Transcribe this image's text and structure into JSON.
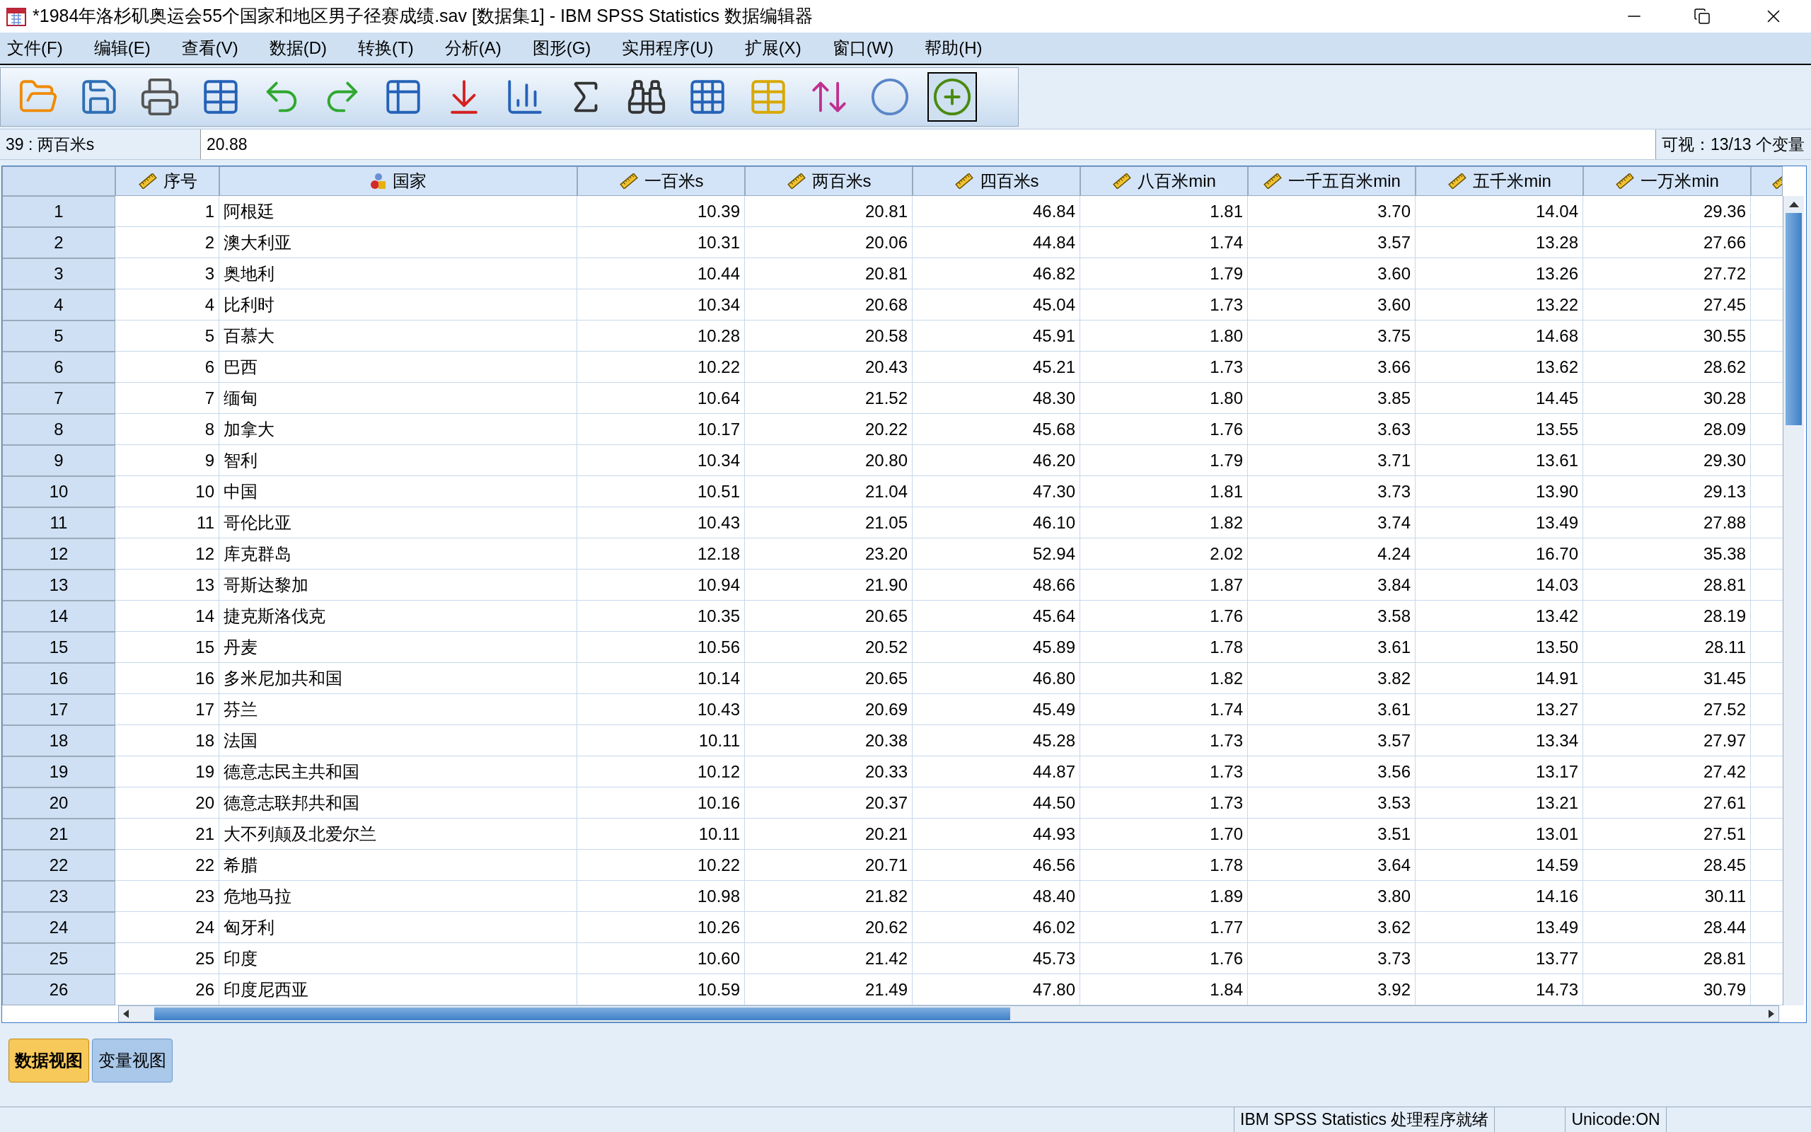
{
  "window": {
    "title": "*1984年洛杉矶奥运会55个国家和地区男子径赛成绩.sav [数据集1] - IBM SPSS Statistics 数据编辑器"
  },
  "menu": [
    "文件(F)",
    "编辑(E)",
    "查看(V)",
    "数据(D)",
    "转换(T)",
    "分析(A)",
    "图形(G)",
    "实用程序(U)",
    "扩展(X)",
    "窗口(W)",
    "帮助(H)"
  ],
  "cell_editor": {
    "reference": "39 : 两百米s",
    "value": "20.88",
    "visible_count": "可视：13/13 个变量"
  },
  "table": {
    "columns": [
      {
        "label": "序号",
        "kind": "scale"
      },
      {
        "label": "国家",
        "kind": "nominal"
      },
      {
        "label": "一百米s",
        "kind": "scale"
      },
      {
        "label": "两百米s",
        "kind": "scale"
      },
      {
        "label": "四百米s",
        "kind": "scale"
      },
      {
        "label": "八百米min",
        "kind": "scale"
      },
      {
        "label": "一千五百米min",
        "kind": "scale"
      },
      {
        "label": "五千米min",
        "kind": "scale"
      },
      {
        "label": "一万米min",
        "kind": "scale"
      }
    ],
    "rows": [
      {
        "number": "1",
        "cells": [
          "1",
          "阿根廷",
          "10.39",
          "20.81",
          "46.84",
          "1.81",
          "3.70",
          "14.04",
          "29.36"
        ]
      },
      {
        "number": "2",
        "cells": [
          "2",
          "澳大利亚",
          "10.31",
          "20.06",
          "44.84",
          "1.74",
          "3.57",
          "13.28",
          "27.66"
        ]
      },
      {
        "number": "3",
        "cells": [
          "3",
          "奥地利",
          "10.44",
          "20.81",
          "46.82",
          "1.79",
          "3.60",
          "13.26",
          "27.72"
        ]
      },
      {
        "number": "4",
        "cells": [
          "4",
          "比利时",
          "10.34",
          "20.68",
          "45.04",
          "1.73",
          "3.60",
          "13.22",
          "27.45"
        ]
      },
      {
        "number": "5",
        "cells": [
          "5",
          "百慕大",
          "10.28",
          "20.58",
          "45.91",
          "1.80",
          "3.75",
          "14.68",
          "30.55"
        ]
      },
      {
        "number": "6",
        "cells": [
          "6",
          "巴西",
          "10.22",
          "20.43",
          "45.21",
          "1.73",
          "3.66",
          "13.62",
          "28.62"
        ]
      },
      {
        "number": "7",
        "cells": [
          "7",
          "缅甸",
          "10.64",
          "21.52",
          "48.30",
          "1.80",
          "3.85",
          "14.45",
          "30.28"
        ]
      },
      {
        "number": "8",
        "cells": [
          "8",
          "加拿大",
          "10.17",
          "20.22",
          "45.68",
          "1.76",
          "3.63",
          "13.55",
          "28.09"
        ]
      },
      {
        "number": "9",
        "cells": [
          "9",
          "智利",
          "10.34",
          "20.80",
          "46.20",
          "1.79",
          "3.71",
          "13.61",
          "29.30"
        ]
      },
      {
        "number": "10",
        "cells": [
          "10",
          "中国",
          "10.51",
          "21.04",
          "47.30",
          "1.81",
          "3.73",
          "13.90",
          "29.13"
        ]
      },
      {
        "number": "11",
        "cells": [
          "11",
          "哥伦比亚",
          "10.43",
          "21.05",
          "46.10",
          "1.82",
          "3.74",
          "13.49",
          "27.88"
        ]
      },
      {
        "number": "12",
        "cells": [
          "12",
          "库克群岛",
          "12.18",
          "23.20",
          "52.94",
          "2.02",
          "4.24",
          "16.70",
          "35.38"
        ]
      },
      {
        "number": "13",
        "cells": [
          "13",
          "哥斯达黎加",
          "10.94",
          "21.90",
          "48.66",
          "1.87",
          "3.84",
          "14.03",
          "28.81"
        ]
      },
      {
        "number": "14",
        "cells": [
          "14",
          "捷克斯洛伐克",
          "10.35",
          "20.65",
          "45.64",
          "1.76",
          "3.58",
          "13.42",
          "28.19"
        ]
      },
      {
        "number": "15",
        "cells": [
          "15",
          "丹麦",
          "10.56",
          "20.52",
          "45.89",
          "1.78",
          "3.61",
          "13.50",
          "28.11"
        ]
      },
      {
        "number": "16",
        "cells": [
          "16",
          "多米尼加共和国",
          "10.14",
          "20.65",
          "46.80",
          "1.82",
          "3.82",
          "14.91",
          "31.45"
        ]
      },
      {
        "number": "17",
        "cells": [
          "17",
          "芬兰",
          "10.43",
          "20.69",
          "45.49",
          "1.74",
          "3.61",
          "13.27",
          "27.52"
        ]
      },
      {
        "number": "18",
        "cells": [
          "18",
          "法国",
          "10.11",
          "20.38",
          "45.28",
          "1.73",
          "3.57",
          "13.34",
          "27.97"
        ]
      },
      {
        "number": "19",
        "cells": [
          "19",
          "德意志民主共和国",
          "10.12",
          "20.33",
          "44.87",
          "1.73",
          "3.56",
          "13.17",
          "27.42"
        ]
      },
      {
        "number": "20",
        "cells": [
          "20",
          "德意志联邦共和国",
          "10.16",
          "20.37",
          "44.50",
          "1.73",
          "3.53",
          "13.21",
          "27.61"
        ]
      },
      {
        "number": "21",
        "cells": [
          "21",
          "大不列颠及北爱尔兰",
          "10.11",
          "20.21",
          "44.93",
          "1.70",
          "3.51",
          "13.01",
          "27.51"
        ]
      },
      {
        "number": "22",
        "cells": [
          "22",
          "希腊",
          "10.22",
          "20.71",
          "46.56",
          "1.78",
          "3.64",
          "14.59",
          "28.45"
        ]
      },
      {
        "number": "23",
        "cells": [
          "23",
          "危地马拉",
          "10.98",
          "21.82",
          "48.40",
          "1.89",
          "3.80",
          "14.16",
          "30.11"
        ]
      },
      {
        "number": "24",
        "cells": [
          "24",
          "匈牙利",
          "10.26",
          "20.62",
          "46.02",
          "1.77",
          "3.62",
          "13.49",
          "28.44"
        ]
      },
      {
        "number": "25",
        "cells": [
          "25",
          "印度",
          "10.60",
          "21.42",
          "45.73",
          "1.76",
          "3.73",
          "13.77",
          "28.81"
        ]
      },
      {
        "number": "26",
        "cells": [
          "26",
          "印度尼西亚",
          "10.59",
          "21.49",
          "47.80",
          "1.84",
          "3.92",
          "14.73",
          "30.79"
        ]
      }
    ]
  },
  "tabs": [
    {
      "label": "数据视图",
      "selected": true
    },
    {
      "label": "变量视图",
      "selected": false
    }
  ],
  "status_bar": {
    "message": "IBM SPSS Statistics 处理程序就绪",
    "unicode": "Unicode:ON"
  }
}
